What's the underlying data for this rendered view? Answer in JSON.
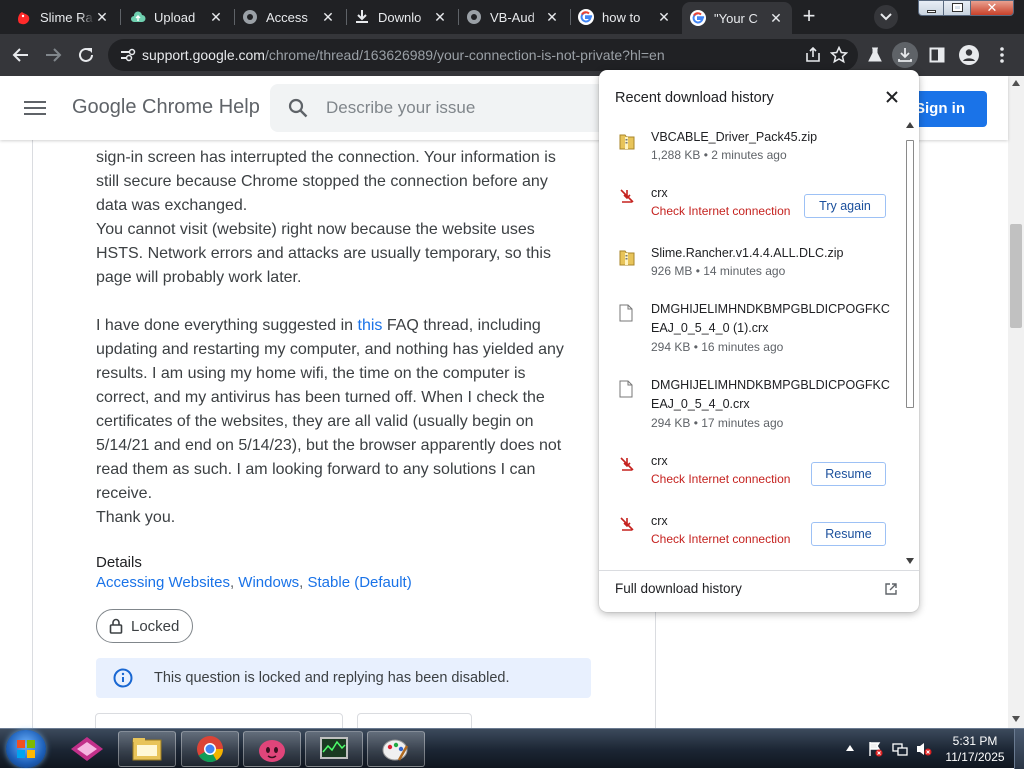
{
  "tabs": [
    {
      "title": "Slime Ra",
      "icon": "youtube-favicon-icon",
      "active": false
    },
    {
      "title": "Upload",
      "icon": "cloud-favicon-icon",
      "active": false
    },
    {
      "title": "Access",
      "icon": "globe-favicon-icon",
      "active": false
    },
    {
      "title": "Downlo",
      "icon": "download-favicon-icon",
      "active": false
    },
    {
      "title": "VB-Aud",
      "icon": "globe-favicon-icon",
      "active": false
    },
    {
      "title": "how to",
      "icon": "google-favicon-icon",
      "active": false
    },
    {
      "title": "\"Your C",
      "icon": "google-favicon-icon",
      "active": true
    }
  ],
  "toolbar": {
    "url_host": "support.google.com",
    "url_path": "/chrome/thread/163626989/your-connection-is-not-private?hl=en"
  },
  "help": {
    "title": "Google Chrome Help",
    "search_placeholder": "Describe your issue",
    "signin_label": "Sign in"
  },
  "post": {
    "paragraph1": [
      "sign-in screen has interrupted the connection. Your information is",
      "still secure because Chrome stopped the connection before any",
      "data was exchanged.",
      "You cannot visit (website) right now because the website uses",
      "HSTS. Network errors and attacks are usually temporary, so this",
      "page will probably work later."
    ],
    "p2_before_link": "I have done everything suggested in ",
    "p2_link": "this",
    "p2_after_link": " FAQ thread, including",
    "paragraph2_rest": [
      "updating and restarting my computer, and nothing has yielded any",
      "results. I am using my home wifi, the time on the computer is",
      "correct, and my antivirus has been turned off. When I check the",
      "certificates of the websites, they are all valid (usually begin on",
      "5/14/21 and end on 5/14/23), but the browser apparently does not",
      "read them as such. I am looking forward to any solutions I can",
      "receive.",
      "Thank you."
    ],
    "details_label": "Details",
    "details_links": [
      "Accessing Websites",
      "Windows",
      "Stable (Default)"
    ],
    "locked_label": "Locked",
    "locked_notice": "This question is locked and replying has been disabled."
  },
  "downloads": {
    "title": "Recent download history",
    "footer_label": "Full download history",
    "items": [
      {
        "name": "VBCABLE_Driver_Pack45.zip",
        "status": "1,288 KB • 2 minutes ago",
        "kind": "archive",
        "error": false,
        "action": ""
      },
      {
        "name": "crx",
        "status": "Check Internet connection",
        "kind": "failed",
        "error": true,
        "action": "Try again"
      },
      {
        "name": "Slime.Rancher.v1.4.4.ALL.DLC.zip",
        "status": "926 MB • 14 minutes ago",
        "kind": "archive",
        "error": false,
        "action": ""
      },
      {
        "name": "DMGHIJELIMHNDKBMPGBLDICPOGFKCEAJ_0_5_4_0 (1).crx",
        "status": "294 KB • 16 minutes ago",
        "kind": "file",
        "error": false,
        "action": ""
      },
      {
        "name": "DMGHIJELIMHNDKBMPGBLDICPOGFKCEAJ_0_5_4_0.crx",
        "status": "294 KB • 17 minutes ago",
        "kind": "file",
        "error": false,
        "action": ""
      },
      {
        "name": "crx",
        "status": "Check Internet connection",
        "kind": "failed",
        "error": true,
        "action": "Resume"
      },
      {
        "name": "crx",
        "status": "Check Internet connection",
        "kind": "failed",
        "error": true,
        "action": "Resume"
      }
    ]
  },
  "taskbar": {
    "apps": [
      "shape-app-icon",
      "file-explorer-icon",
      "chrome-icon",
      "slime-game-icon",
      "task-manager-icon",
      "paint-icon"
    ],
    "time": "5:31 PM",
    "date": "11/17/2025"
  },
  "colors": {
    "accent": "#1a73e8",
    "error": "#c5221f",
    "tabstrip": "#202124",
    "toolbar": "#35363a"
  }
}
